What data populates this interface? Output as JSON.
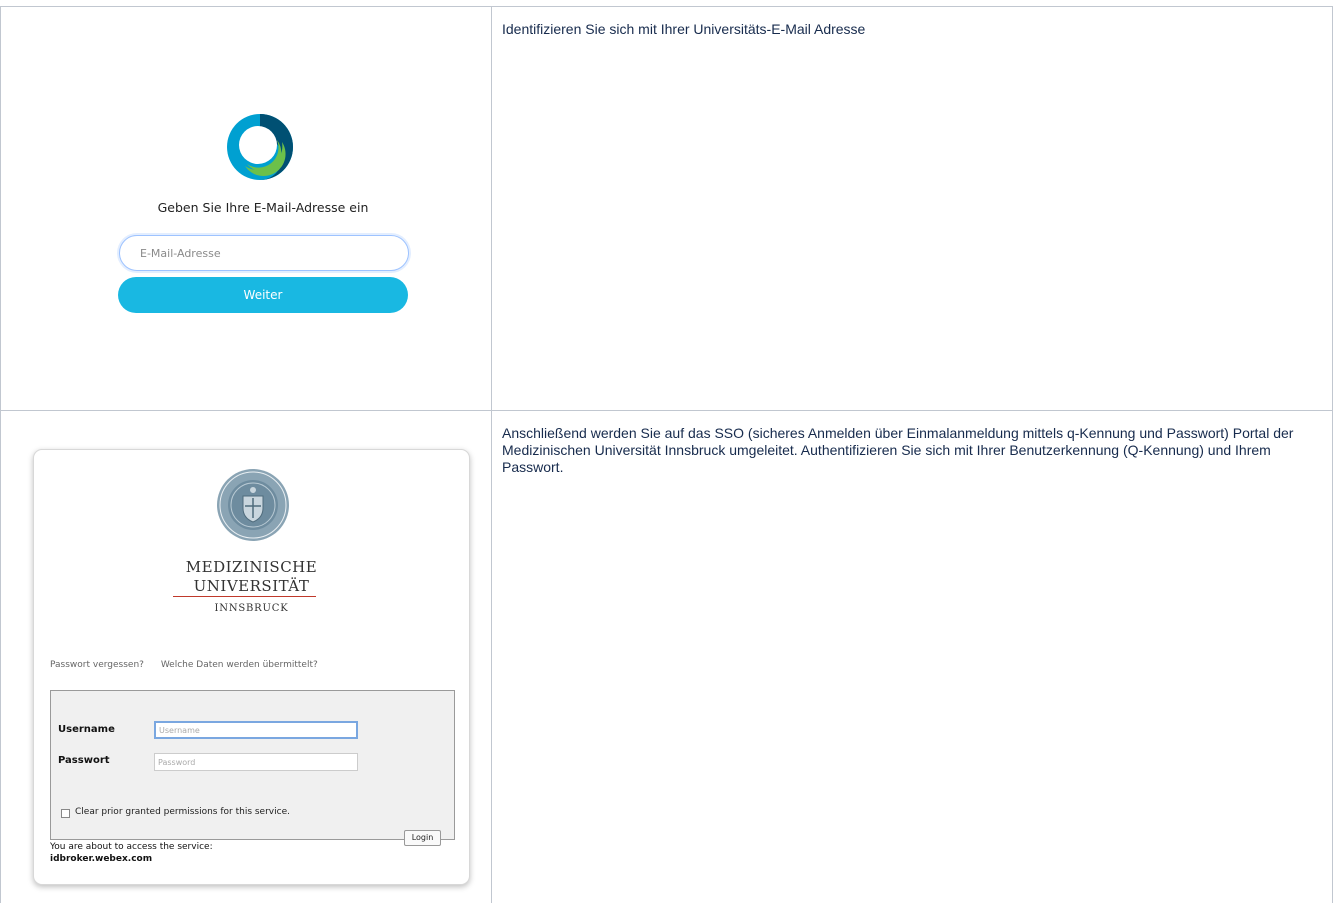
{
  "row1": {
    "webex": {
      "title": "Geben Sie Ihre E-Mail-Adresse ein",
      "email_placeholder": "E-Mail-Adresse",
      "next_label": "Weiter",
      "colors": {
        "logo_outer": "#00a0d1",
        "logo_dark": "#005073",
        "logo_green": "#6cc04a",
        "button": "#19b8e2"
      }
    },
    "description": "Identifizieren Sie sich mit Ihrer Universitäts-E-Mail Adresse"
  },
  "row2": {
    "sso": {
      "university_line1": "MEDIZINISCHE",
      "university_line2": "UNIVERSITÄT",
      "university_line3": "INNSBRUCK",
      "link_forgot": "Passwort vergessen?",
      "link_data": "Welche Daten werden übermittelt?",
      "username_label": "Username",
      "username_placeholder": "Username",
      "password_label": "Passwort",
      "password_placeholder": "Password",
      "clear_permissions_label": "Clear prior granted permissions for this service.",
      "login_label": "Login",
      "service_text": "You are about to access the service:",
      "service_host": "idbroker.webex.com"
    },
    "description": "Anschließend werden Sie auf das SSO (sicheres Anmelden über Einmalanmeldung mittels q-Kennung und Passwort) Portal der Medizinischen Universität Innsbruck umgeleitet. Authentifizieren Sie sich mit Ihrer Benutzerkennung (Q-Kennung) und Ihrem Passwort."
  }
}
